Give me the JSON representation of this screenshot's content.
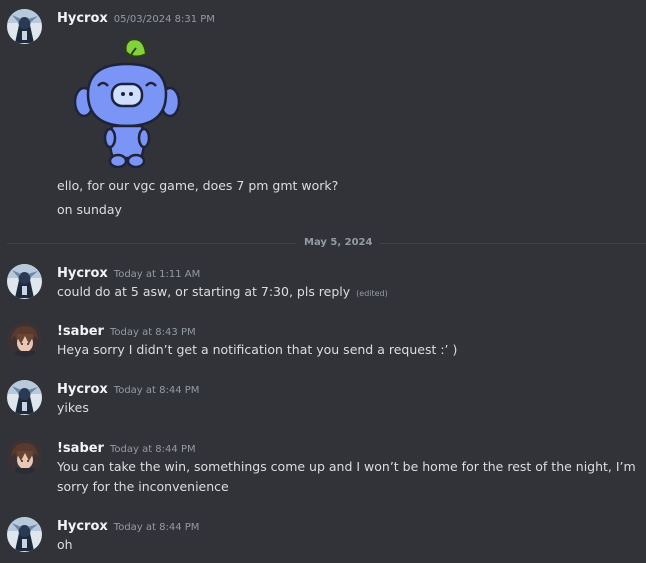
{
  "date_divider": "May 5, 2024",
  "messages": [
    {
      "username": "Hycrox",
      "timestamp": "05/03/2024 8:31 PM",
      "sticker": "wumpus-leaf-sticker",
      "lines": [
        "ello, for our vgc game, does 7 pm gmt work?",
        "on sunday"
      ]
    },
    {
      "username": "Hycrox",
      "timestamp": "Today at 1:11 AM",
      "text": "could do at 5 asw, or starting at 7:30, pls reply",
      "edited": "(edited)"
    },
    {
      "username": "!saber",
      "timestamp": "Today at 8:43 PM",
      "text": "Heya sorry I didn’t get a notification that you send a request :’ )"
    },
    {
      "username": "Hycrox",
      "timestamp": "Today at 8:44 PM",
      "text": "yikes"
    },
    {
      "username": "!saber",
      "timestamp": "Today at 8:44 PM",
      "text": "You can take the win, somethings come up and I won’t be home for the rest of the night, I’m sorry for the inconvenience"
    },
    {
      "username": "Hycrox",
      "timestamp": "Today at 8:44 PM",
      "text": "oh"
    }
  ],
  "colors": {
    "background": "#313338",
    "username": "#f2f3f5",
    "text": "#dbdee1",
    "muted": "#949ba4",
    "wumpus": "#7a95f5",
    "leaf": "#82d23a"
  }
}
